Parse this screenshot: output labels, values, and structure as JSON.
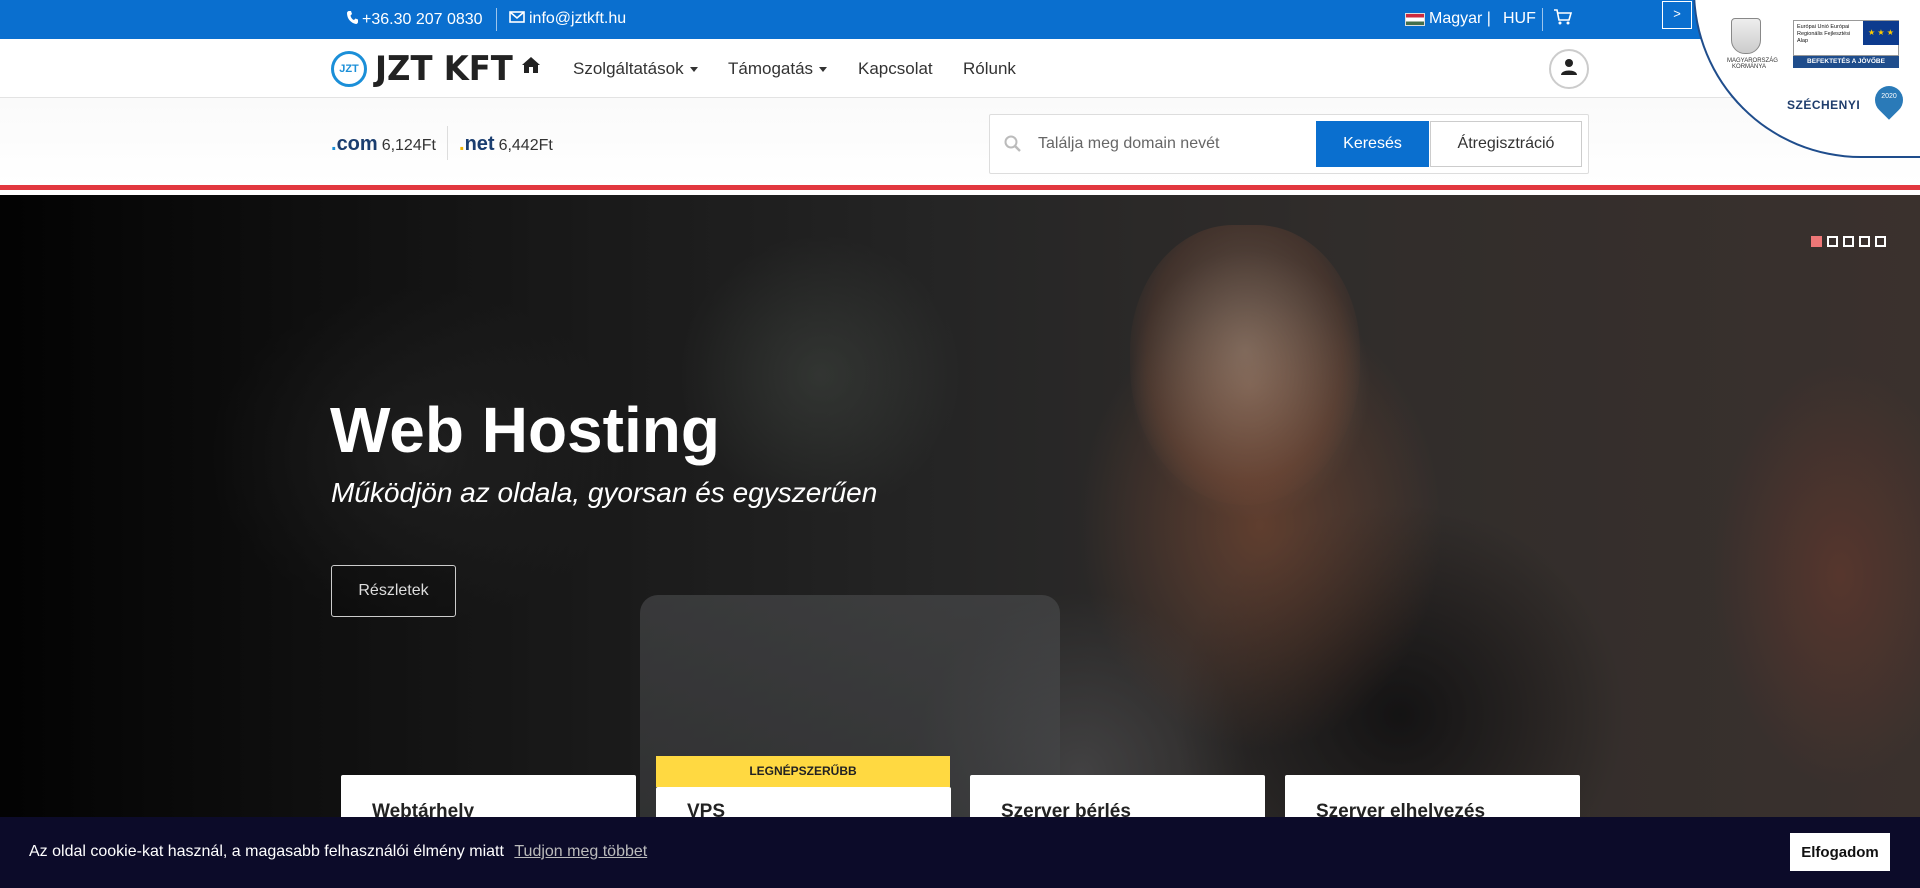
{
  "topbar": {
    "phone": "+36.30 207 0830",
    "email": "info@jztkft.hu",
    "language": "Magyar |",
    "currency": "HUF",
    "toggle": ">"
  },
  "nav": {
    "logo_badge": "JZT",
    "logo_text": "JZT KFT",
    "items": [
      {
        "label": "Szolgáltatások"
      },
      {
        "label": "Támogatás"
      },
      {
        "label": "Kapcsolat"
      },
      {
        "label": "Rólunk"
      }
    ]
  },
  "domains": {
    "tlds": [
      {
        "ext": "com",
        "price": "6,124Ft"
      },
      {
        "ext": "net",
        "price": "6,442Ft"
      }
    ],
    "search_placeholder": "Találja meg domain nevét",
    "search_button": "Keresés",
    "transfer_button": "Átregisztráció"
  },
  "badge": {
    "crest_text": "MAGYARORSZÁG KORMÁNYA",
    "eu_text": "Európai Unió Európai Regionális Fejlesztési Alap",
    "eu_band": "BEFEKTETÉS A JÖVŐBE",
    "szechenyi": "SZÉCHENYI",
    "pin_text": "2020"
  },
  "hero": {
    "title": "Web Hosting",
    "subtitle": "Működjön az oldala, gyorsan és egyszerűen",
    "button": "Részletek",
    "slides_total": 5,
    "active_slide": 1
  },
  "cards": {
    "popular_label": "LEGNÉPSZERŰBB",
    "items": [
      {
        "title": "Webtárhely"
      },
      {
        "title": "VPS"
      },
      {
        "title": "Szerver bérlés"
      },
      {
        "title": "Szerver elhelyezés"
      }
    ]
  },
  "cookie": {
    "message": "Az oldal cookie-kat használ, a magasabb felhasználói élmény miatt",
    "learn_more": "Tudjon meg többet",
    "accept": "Elfogadom"
  },
  "colors": {
    "primary": "#0a6fcf",
    "accent_red": "#e2383f",
    "popular_yellow": "#ffd941",
    "cookie_bg": "#0c0b29"
  }
}
